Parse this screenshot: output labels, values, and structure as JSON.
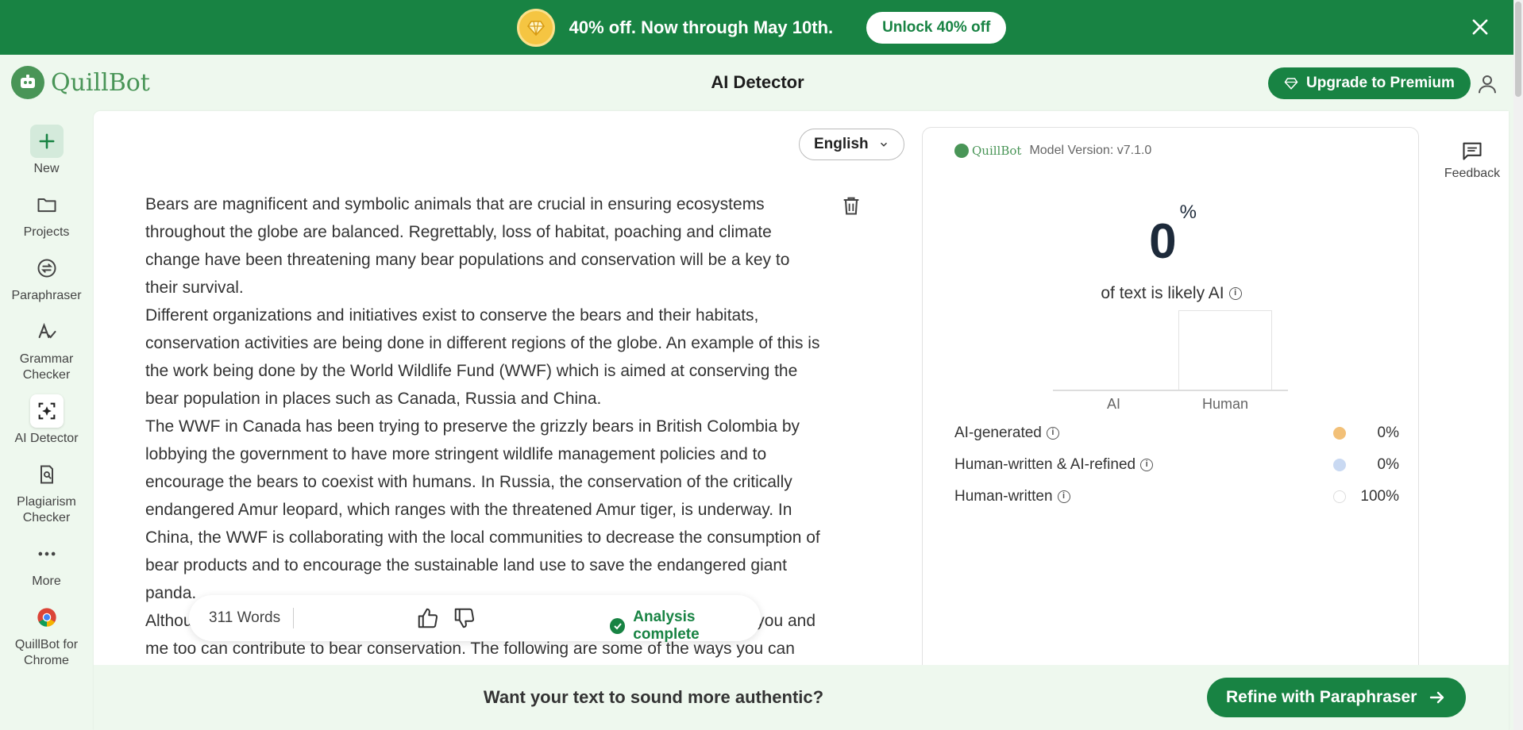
{
  "promo": {
    "icon": "gem-badge-icon",
    "text": "40% off. Now through May 10th.",
    "cta": "Unlock 40% off"
  },
  "header": {
    "brand": "QuillBot",
    "title": "AI Detector",
    "upgrade_label": "Upgrade to Premium"
  },
  "rail": {
    "items": [
      {
        "label": "New",
        "icon": "plus-icon"
      },
      {
        "label": "Projects",
        "icon": "folder-icon"
      },
      {
        "label": "Paraphraser",
        "icon": "paraphraser-icon"
      },
      {
        "label": "Grammar Checker",
        "icon": "grammar-icon"
      },
      {
        "label": "AI Detector",
        "icon": "ai-detector-icon"
      },
      {
        "label": "Plagiarism Checker",
        "icon": "plagiarism-icon"
      },
      {
        "label": "More",
        "icon": "more-icon"
      },
      {
        "label": "QuillBot for Chrome",
        "icon": "chrome-icon"
      }
    ]
  },
  "editor": {
    "language": "English",
    "paragraphs": [
      "Bears are magnificent and symbolic animals that are crucial in ensuring ecosystems throughout the globe are balanced. Regrettably, loss of habitat, poaching and climate change have been threatening many bear populations and conservation will be a key to their survival.",
      "Different organizations and initiatives exist to conserve the bears and their habitats, conservation activities are being done in different regions of the globe. An example of this is the work being done by the World Wildlife Fund (WWF) which is aimed at conserving the bear population in places such as Canada, Russia and China.",
      "The WWF in Canada has been trying to preserve the grizzly bears in British Colombia by lobbying the government to have more stringent wildlife management policies and to encourage the bears to coexist with humans. In Russia, the conservation of the critically endangered Amur leopard, which ranges with the threatened Amur tiger, is underway. In China, the WWF is collaborating with the local communities to decrease the consumption of bear products and to encourage the sustainable land use to save the endangered giant panda.",
      "Although organizations play an important role in bear conservation, individuals like you and me too can contribute to bear conservation. The following are some of the ways you can help:"
    ],
    "word_count": "311 Words",
    "status": "Analysis complete"
  },
  "results": {
    "brand": "QuillBot",
    "model_version": "Model Version: v7.1.0",
    "percent": "0",
    "percent_sign": "%",
    "caption": "of text is likely AI",
    "chart_labels": {
      "ai": "AI",
      "human": "Human"
    },
    "rows": [
      {
        "label": "AI-generated",
        "value": "0%",
        "color": "#f2c078"
      },
      {
        "label": "Human-written & AI-refined",
        "value": "0%",
        "color": "#c9d9f2"
      },
      {
        "label": "Human-written",
        "value": "100%",
        "color": "#ffffff"
      }
    ]
  },
  "feedback": {
    "label": "Feedback"
  },
  "cta": {
    "text": "Want your text to sound more authentic?",
    "button": "Refine with Paraphraser"
  },
  "colors": {
    "brand_green": "#188343",
    "logo_green": "#499557",
    "bg_mint": "#eef8ee"
  }
}
